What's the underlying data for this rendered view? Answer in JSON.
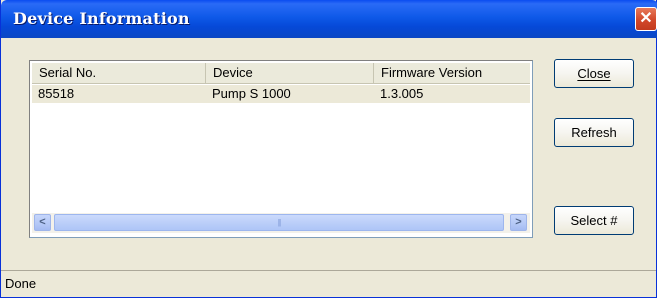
{
  "window": {
    "title": "Device Information",
    "close_glyph": "✕"
  },
  "list": {
    "columns": [
      "Serial No.",
      "Device",
      "Firmware Version"
    ],
    "rows": [
      [
        "85518",
        "Pump S 1000",
        "1.3.005"
      ]
    ],
    "selected_row": 0,
    "scrollbar": {
      "left_arrow": "<",
      "right_arrow": ">",
      "grip": "|||"
    }
  },
  "buttons": {
    "close": "Close",
    "refresh": "Refresh",
    "select": "Select #"
  },
  "status": {
    "text": "Done"
  },
  "colors": {
    "titlebar": "#0a4cf0",
    "window_bg": "#ece9d8",
    "close_button": "#d2482a",
    "scroll_thumb": "#bccff9"
  }
}
